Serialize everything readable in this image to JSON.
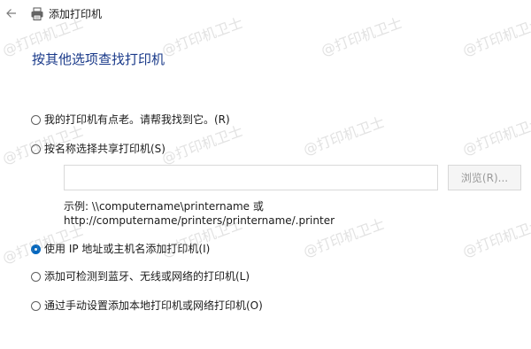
{
  "window": {
    "title": "添加打印机",
    "back_icon": "back-arrow-icon",
    "printer_icon": "printer-icon"
  },
  "heading": "按其他选项查找打印机",
  "options": [
    {
      "label": "我的打印机有点老。请帮我找到它。(R)",
      "checked": false
    },
    {
      "label": "按名称选择共享打印机(S)",
      "checked": false
    },
    {
      "label": "使用 IP 地址或主机名添加打印机(I)",
      "checked": true
    },
    {
      "label": "添加可检测到蓝牙、无线或网络的打印机(L)",
      "checked": false
    },
    {
      "label": "通过手动设置添加本地打印机或网络打印机(O)",
      "checked": false
    }
  ],
  "shared_printer": {
    "input_value": "",
    "browse_label": "浏览(R)...",
    "example_line1": "示例: \\\\computername\\printername 或",
    "example_line2": "http://computername/printers/printername/.printer"
  },
  "watermark": "@打印机卫士",
  "colors": {
    "heading": "#1a3a8a",
    "accent": "#0067c0",
    "disabled_text": "#9a9a9a"
  }
}
